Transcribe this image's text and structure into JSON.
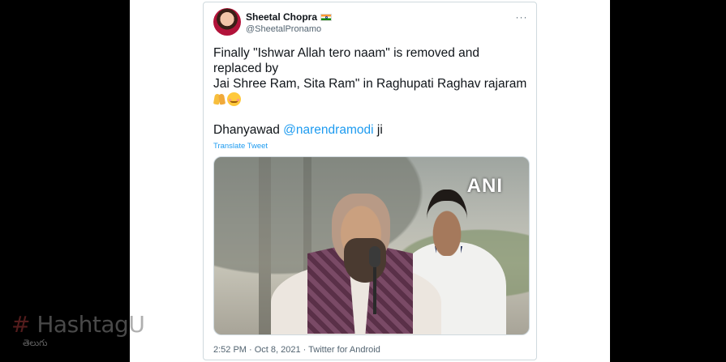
{
  "tweet": {
    "display_name": "Sheetal Chopra",
    "handle": "@SheetalPronamo",
    "more_label": "···",
    "lines": [
      "Finally \"Ishwar Allah tero naam\" is removed and",
      "replaced by",
      "Jai Shree Ram, Sita Ram\" in Raghupati Raghav rajaram"
    ],
    "emojis": [
      "folded-hands-emoji",
      "smiling-face-emoji"
    ],
    "thanks_prefix": "Dhanyawad ",
    "mention": "@narendramodi",
    "thanks_suffix": " ji",
    "translate_label": "Translate Tweet",
    "media_watermark": "ANI",
    "footer": "2:52 PM · Oct 8, 2021 · Twitter for Android"
  },
  "overlay": {
    "brand_hash": "#",
    "brand_name": " HashtagU",
    "brand_sub": "తెలుగు"
  },
  "colors": {
    "link": "#1d9bf0",
    "text": "#0f1419",
    "muted": "#536471"
  }
}
